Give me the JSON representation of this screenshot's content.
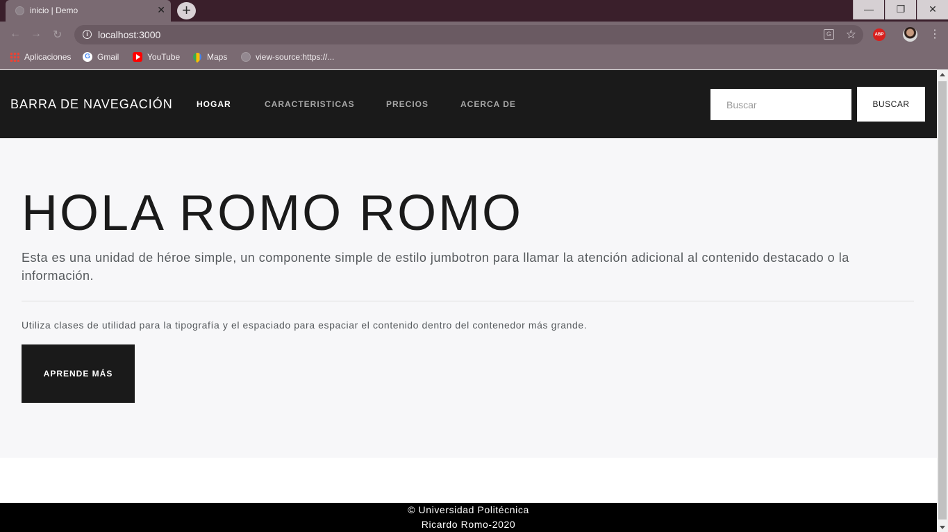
{
  "browser": {
    "tab_title": "inicio | Demo",
    "tab_close": "✕",
    "new_tab": "+",
    "window_controls": {
      "minimize": "—",
      "restore": "❐",
      "close": "✕"
    },
    "url": "localhost:3000",
    "icons": [
      "back-icon",
      "forward-icon",
      "reload-icon",
      "info-icon",
      "translate-icon",
      "star-icon",
      "abp-icon",
      "avatar",
      "menu-icon"
    ],
    "bookmarks": [
      {
        "label": "Aplicaciones",
        "icon": "apps-icon"
      },
      {
        "label": "Gmail",
        "icon": "gmail-icon"
      },
      {
        "label": "YouTube",
        "icon": "youtube-icon"
      },
      {
        "label": "Maps",
        "icon": "maps-icon"
      },
      {
        "label": "view-source:https://...",
        "icon": "globe-icon"
      }
    ],
    "abp_text": "ABP"
  },
  "navbar": {
    "brand": "BARRA DE NAVEGACIÓN",
    "links": [
      {
        "label": "HOGAR",
        "active": true
      },
      {
        "label": "CARACTERISTICAS",
        "active": false
      },
      {
        "label": "PRECIOS",
        "active": false
      },
      {
        "label": "ACERCA DE",
        "active": false
      }
    ],
    "search_placeholder": "Buscar",
    "search_button": "BUSCAR"
  },
  "jumbotron": {
    "title": "HOLA ROMO ROMO",
    "lead": "Esta es una unidad de héroe simple, un componente simple de estilo jumbotron para llamar la atención adicional al contenido destacado o la información.",
    "text": "Utiliza clases de utilidad para la tipografía y el espaciado para espaciar el contenido dentro del contenedor más grande.",
    "button": "APRENDE MÁS"
  },
  "footer": {
    "line1": "© Universidad Politécnica",
    "line2": "Ricardo Romo-2020"
  }
}
